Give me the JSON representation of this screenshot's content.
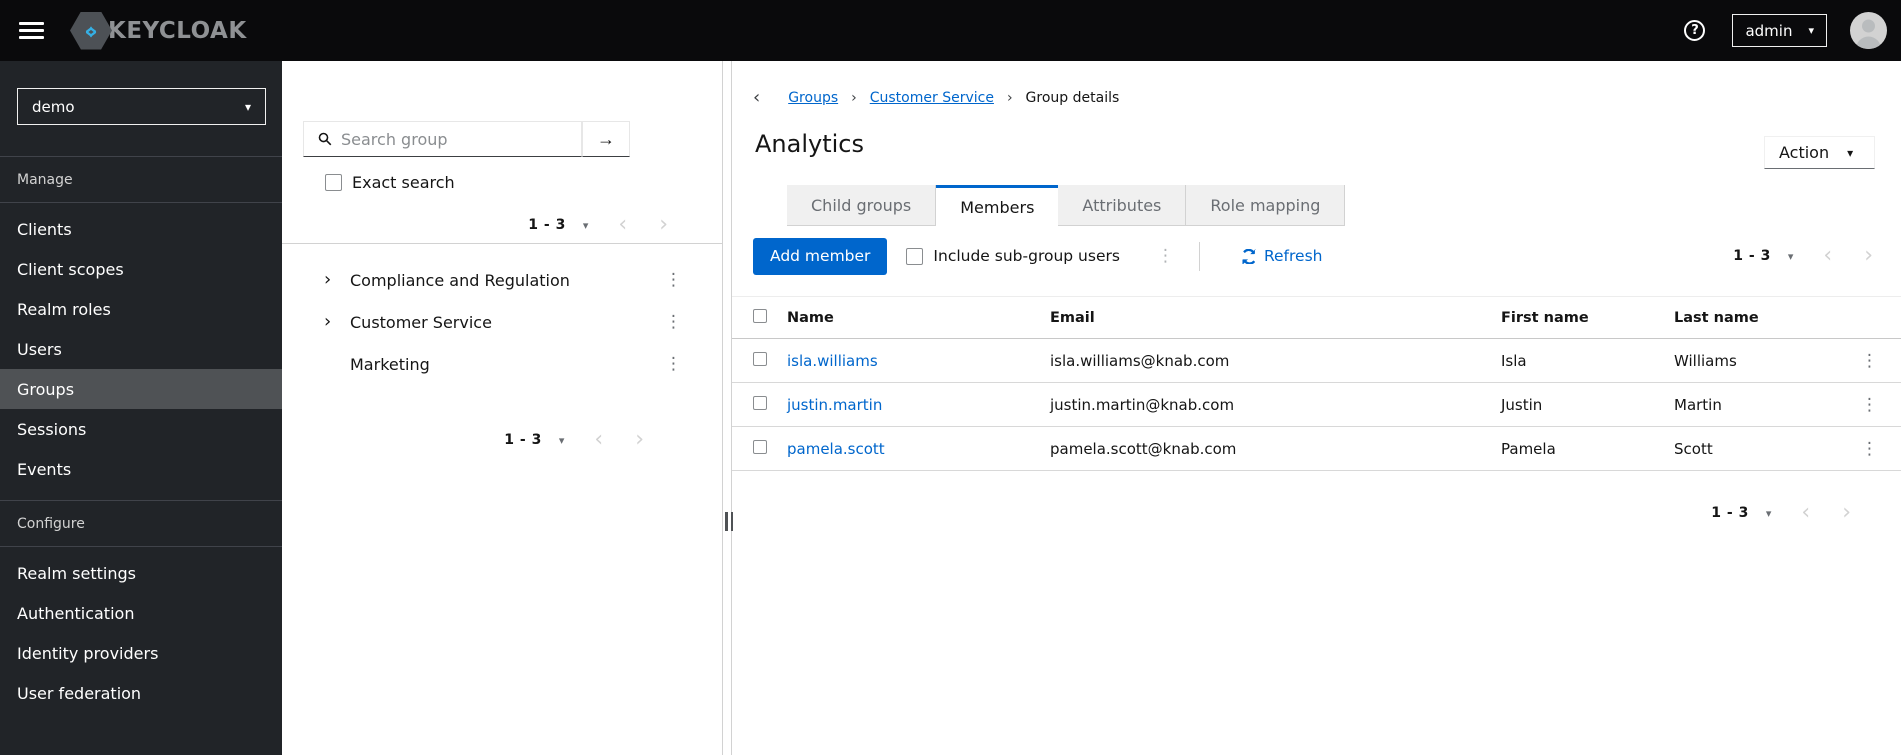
{
  "colors": {
    "accent": "#0066cc",
    "masthead_bg": "#0a0a0c",
    "nav_bg": "#212428",
    "nav_selected": "#4f5255",
    "border": "#d2d2d2",
    "muted_text": "#6a6e73"
  },
  "topbar": {
    "brand": "KEYCLOAK",
    "user": "admin"
  },
  "sidebar": {
    "realm": "demo",
    "manage": {
      "label": "Manage",
      "items": [
        "Clients",
        "Client scopes",
        "Realm roles",
        "Users",
        "Groups",
        "Sessions",
        "Events"
      ],
      "selected": "Groups"
    },
    "configure": {
      "label": "Configure",
      "items": [
        "Realm settings",
        "Authentication",
        "Identity providers",
        "User federation"
      ]
    }
  },
  "groups": {
    "search_placeholder": "Search group",
    "exact_label": "Exact search",
    "pg_top": "1 - 3",
    "pg_bottom": "1 - 3",
    "tree": [
      {
        "label": "Compliance and Regulation",
        "expandable": true
      },
      {
        "label": "Customer Service",
        "expandable": true
      },
      {
        "label": "Marketing",
        "expandable": false
      }
    ]
  },
  "main": {
    "breadcrumb": [
      "Groups",
      "Customer Service",
      "Group details"
    ],
    "title": "Analytics",
    "action_label": "Action",
    "tabs": [
      {
        "label": "Child groups",
        "active": false
      },
      {
        "label": "Members",
        "active": true
      },
      {
        "label": "Attributes",
        "active": false
      },
      {
        "label": "Role mapping",
        "active": false
      }
    ],
    "toolbar": {
      "add_label": "Add member",
      "include_label": "Include sub-group users",
      "refresh_label": "Refresh",
      "pg": "1 - 3"
    },
    "table": {
      "headers": [
        "Name",
        "Email",
        "First name",
        "Last name"
      ],
      "rows": [
        {
          "name": "isla.williams",
          "email": "isla.williams@knab.com",
          "first": "Isla",
          "last": "Williams"
        },
        {
          "name": "justin.martin",
          "email": "justin.martin@knab.com",
          "first": "Justin",
          "last": "Martin"
        },
        {
          "name": "pamela.scott",
          "email": "pamela.scott@knab.com",
          "first": "Pamela",
          "last": "Scott"
        }
      ]
    },
    "footer_pg": "1 - 3"
  }
}
